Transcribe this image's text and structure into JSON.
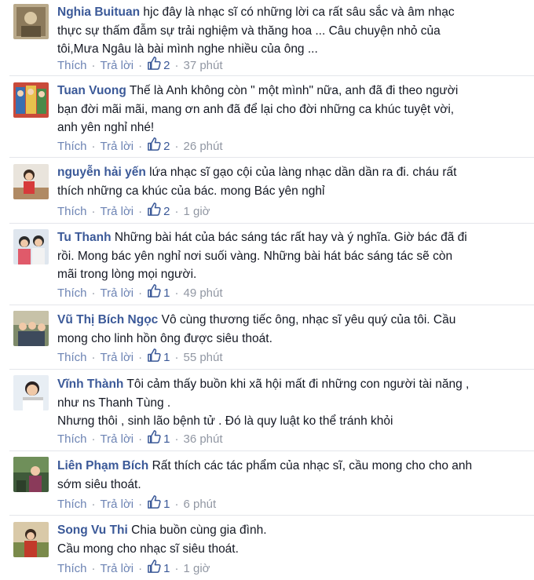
{
  "comments": [
    {
      "author": "Nghia Buituan",
      "lines": [
        "hjc đây là nhạc sĩ có những lời ca rất sâu sắc và âm nhạc",
        "thực sự thấm đẫm sự trải nghiệm và thăng hoa ... Câu chuyện nhỏ của",
        "tôi,Mưa Ngâu là bài mình nghe nhiều của ông ..."
      ],
      "like_label": "Thích",
      "reply_label": "Trả lời",
      "likes": "2",
      "time": "37 phút"
    },
    {
      "author": "Tuan Vuong",
      "lines": [
        "Thế là Anh không còn \" một mình\" nữa, anh đã đi theo người",
        "bạn đời mãi mãi, mang ơn anh đã để lại cho đời những ca khúc tuyệt vời,",
        "anh yên nghỉ nhé!"
      ],
      "like_label": "Thích",
      "reply_label": "Trả lời",
      "likes": "2",
      "time": "26 phút"
    },
    {
      "author": "nguyễn hải yến",
      "lines": [
        "lứa nhạc sĩ gạo cội của làng nhạc dần dần ra đi. cháu rất",
        "thích những ca khúc của bác. mong Bác yên nghỉ"
      ],
      "like_label": "Thích",
      "reply_label": "Trả lời",
      "likes": "2",
      "time": "1 giờ"
    },
    {
      "author": "Tu Thanh",
      "lines": [
        "Những bài hát của bác sáng tác rất hay và ý nghĩa. Giờ bác đã đi",
        "rồi. Mong bác yên nghỉ nơi suối vàng. Những bài hát bác sáng tác sẽ còn",
        "mãi trong lòng mọi người."
      ],
      "like_label": "Thích",
      "reply_label": "Trả lời",
      "likes": "1",
      "time": "49 phút"
    },
    {
      "author": "Vũ Thị Bích Ngọc",
      "lines": [
        "Vô cùng thương tiếc ông, nhạc sĩ yêu quý của tôi. Cầu",
        "mong cho linh hồn ông được siêu thoát."
      ],
      "like_label": "Thích",
      "reply_label": "Trả lời",
      "likes": "1",
      "time": "55 phút"
    },
    {
      "author": "Vĩnh Thành",
      "lines": [
        "Tôi cảm thấy buồn khi xã hội mất đi những con người tài năng ,",
        "như ns Thanh Tùng .",
        "Nhưng thôi , sinh lão bệnh tử . Đó là quy luật ko thể tránh khỏi"
      ],
      "like_label": "Thích",
      "reply_label": "Trả lời",
      "likes": "1",
      "time": "36 phút"
    },
    {
      "author": "Liên Phạm Bích",
      "lines": [
        "Rất thích các tác phẩm của nhạc sĩ, cầu mong cho cho anh",
        "sớm siêu thoát."
      ],
      "like_label": "Thích",
      "reply_label": "Trả lời",
      "likes": "1",
      "time": "6 phút"
    },
    {
      "author": "Song Vu Thi",
      "lines": [
        "Chia buồn cùng gia đình.",
        "Cầu mong cho nhạc sĩ siêu thoát."
      ],
      "like_label": "Thích",
      "reply_label": "Trả lời",
      "likes": "1",
      "time": "1 giờ"
    }
  ],
  "separator": "·",
  "colors": {
    "author": "#3b5998",
    "action_link": "#6d84b4",
    "meta": "#9197a3",
    "text": "#141823"
  },
  "icons": {
    "like": "thumbs-up-icon"
  }
}
